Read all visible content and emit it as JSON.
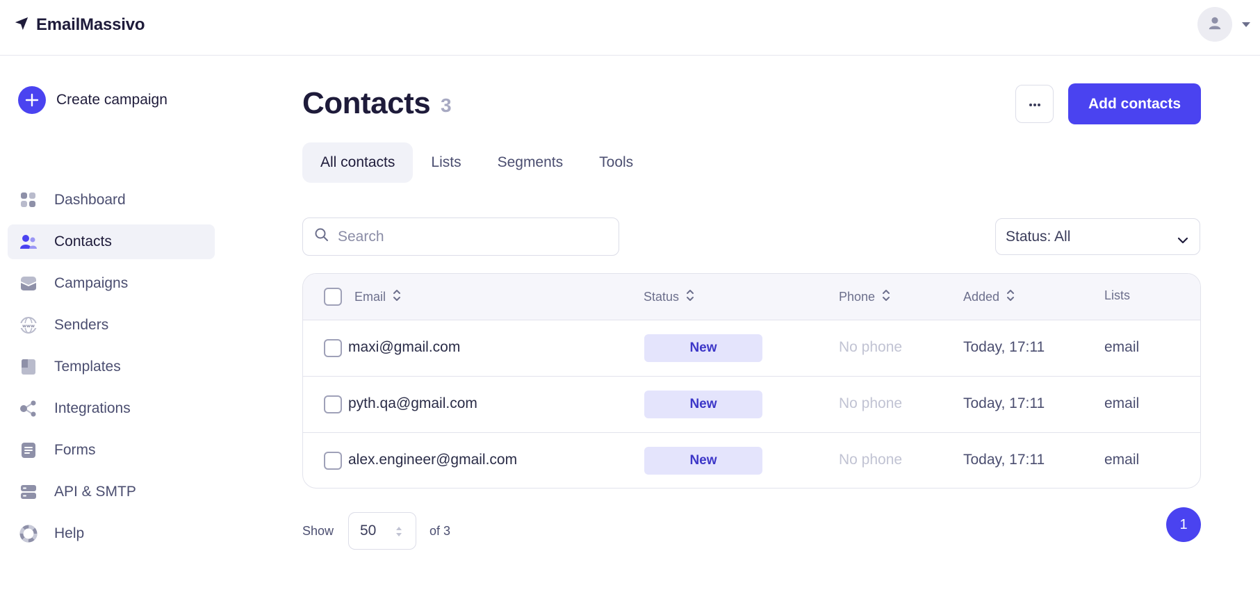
{
  "app": {
    "brand": "EmailMassivo"
  },
  "sidebar": {
    "create_label": "Create campaign",
    "items": [
      {
        "label": "Dashboard",
        "icon": "dashboard-icon"
      },
      {
        "label": "Contacts",
        "icon": "contacts-icon",
        "active": true
      },
      {
        "label": "Campaigns",
        "icon": "campaigns-icon"
      },
      {
        "label": "Senders",
        "icon": "senders-icon"
      },
      {
        "label": "Templates",
        "icon": "templates-icon"
      },
      {
        "label": "Integrations",
        "icon": "integrations-icon"
      },
      {
        "label": "Forms",
        "icon": "forms-icon"
      },
      {
        "label": "API & SMTP",
        "icon": "api-smtp-icon"
      },
      {
        "label": "Help",
        "icon": "help-icon"
      }
    ]
  },
  "header": {
    "title": "Contacts",
    "count": "3",
    "add_label": "Add contacts"
  },
  "tabs": [
    {
      "label": "All contacts",
      "active": true
    },
    {
      "label": "Lists"
    },
    {
      "label": "Segments"
    },
    {
      "label": "Tools"
    }
  ],
  "search": {
    "placeholder": "Search",
    "value": ""
  },
  "status_filter": {
    "value": "Status: All"
  },
  "table": {
    "columns": {
      "email": "Email",
      "status": "Status",
      "phone": "Phone",
      "added": "Added",
      "lists": "Lists"
    },
    "rows": [
      {
        "email": "maxi@gmail.com",
        "status": "New",
        "phone": "No phone",
        "added": "Today, 17:11",
        "lists": "email"
      },
      {
        "email": "pyth.qa@gmail.com",
        "status": "New",
        "phone": "No phone",
        "added": "Today, 17:11",
        "lists": "email"
      },
      {
        "email": "alex.engineer@gmail.com",
        "status": "New",
        "phone": "No phone",
        "added": "Today, 17:11",
        "lists": "email"
      }
    ]
  },
  "pagination": {
    "show_label": "Show",
    "page_size": "50",
    "of_label": "of 3",
    "current_page": "1"
  },
  "colors": {
    "accent": "#4a43f0",
    "badge_bg": "#e4e4fc",
    "text_dark": "#1e1b3a",
    "muted": "#4b4e70"
  }
}
